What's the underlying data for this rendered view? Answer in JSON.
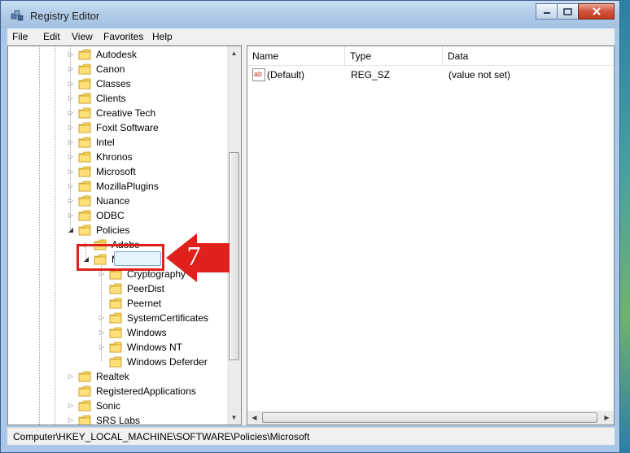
{
  "window": {
    "title": "Registry Editor",
    "accent_color": "#a9c7e8",
    "close_color": "#c23a1f"
  },
  "menu": [
    "File",
    "Edit",
    "View",
    "Favorites",
    "Help"
  ],
  "tree": {
    "items": [
      {
        "label": "Autodesk",
        "level": 0,
        "expander": "collapsed"
      },
      {
        "label": "Canon",
        "level": 0,
        "expander": "collapsed"
      },
      {
        "label": "Classes",
        "level": 0,
        "expander": "collapsed"
      },
      {
        "label": "Clients",
        "level": 0,
        "expander": "collapsed"
      },
      {
        "label": "Creative Tech",
        "level": 0,
        "expander": "collapsed"
      },
      {
        "label": "Foxit Software",
        "level": 0,
        "expander": "collapsed"
      },
      {
        "label": "Intel",
        "level": 0,
        "expander": "collapsed"
      },
      {
        "label": "Khronos",
        "level": 0,
        "expander": "collapsed"
      },
      {
        "label": "Microsoft",
        "level": 0,
        "expander": "collapsed"
      },
      {
        "label": "MozillaPlugins",
        "level": 0,
        "expander": "collapsed"
      },
      {
        "label": "Nuance",
        "level": 0,
        "expander": "collapsed"
      },
      {
        "label": "ODBC",
        "level": 0,
        "expander": "collapsed"
      },
      {
        "label": "Policies",
        "level": 0,
        "expander": "expanded"
      },
      {
        "label": "Adobe",
        "level": 1,
        "expander": "collapsed"
      },
      {
        "label": "Microsoft",
        "level": 1,
        "expander": "expanded",
        "selected": true
      },
      {
        "label": "Cryptography",
        "level": 2,
        "expander": "collapsed"
      },
      {
        "label": "PeerDist",
        "level": 2,
        "expander": "none"
      },
      {
        "label": "Peernet",
        "level": 2,
        "expander": "none"
      },
      {
        "label": "SystemCertificates",
        "level": 2,
        "expander": "collapsed"
      },
      {
        "label": "Windows",
        "level": 2,
        "expander": "collapsed"
      },
      {
        "label": "Windows NT",
        "level": 2,
        "expander": "collapsed"
      },
      {
        "label": "Windows Deferder",
        "level": 2,
        "expander": "none"
      },
      {
        "label": "Realtek",
        "level": 0,
        "expander": "collapsed"
      },
      {
        "label": "RegisteredApplications",
        "level": 0,
        "expander": "none"
      },
      {
        "label": "Sonic",
        "level": 0,
        "expander": "collapsed"
      },
      {
        "label": "SRS Labs",
        "level": 0,
        "expander": "collapsed"
      }
    ]
  },
  "list": {
    "columns": [
      "Name",
      "Type",
      "Data"
    ],
    "rows": [
      {
        "icon": "string-value-icon",
        "icon_text": "ab",
        "name": "(Default)",
        "type": "REG_SZ",
        "data": "(value not set)"
      }
    ]
  },
  "status": {
    "path": "Computer\\HKEY_LOCAL_MACHINE\\SOFTWARE\\Policies\\Microsoft"
  },
  "annotation": {
    "step_number": "7",
    "color": "#e0201b"
  }
}
